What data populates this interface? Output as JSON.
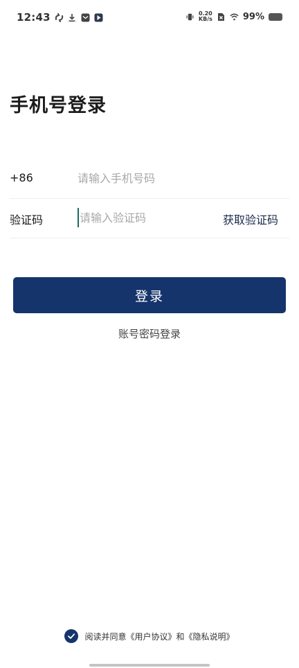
{
  "status_bar": {
    "time": "12:43",
    "net_speed_value": "0.20",
    "net_speed_unit": "KB/s",
    "battery_pct": "99%",
    "icons_left": [
      "sync-icon",
      "download-icon",
      "mail-icon",
      "play-store-icon"
    ],
    "icons_right": [
      "vibrate-icon",
      "net-speed",
      "sim-off-icon",
      "wifi-icon",
      "battery-icon"
    ]
  },
  "page": {
    "title": "手机号登录"
  },
  "phone_row": {
    "prefix": "+86",
    "placeholder": "请输入手机号码",
    "value": ""
  },
  "code_row": {
    "label": "验证码",
    "placeholder": "请输入验证码",
    "value": "",
    "get_code_label": "获取验证码"
  },
  "login": {
    "button_label": "登录",
    "password_login_label": "账号密码登录"
  },
  "agreement": {
    "checked": true,
    "text": "阅读并同意《用户协议》和《隐私说明》"
  },
  "colors": {
    "primary": "#15346b",
    "placeholder": "#a8a8a8",
    "divider": "#efefef",
    "cursor": "#1c6b5a"
  }
}
